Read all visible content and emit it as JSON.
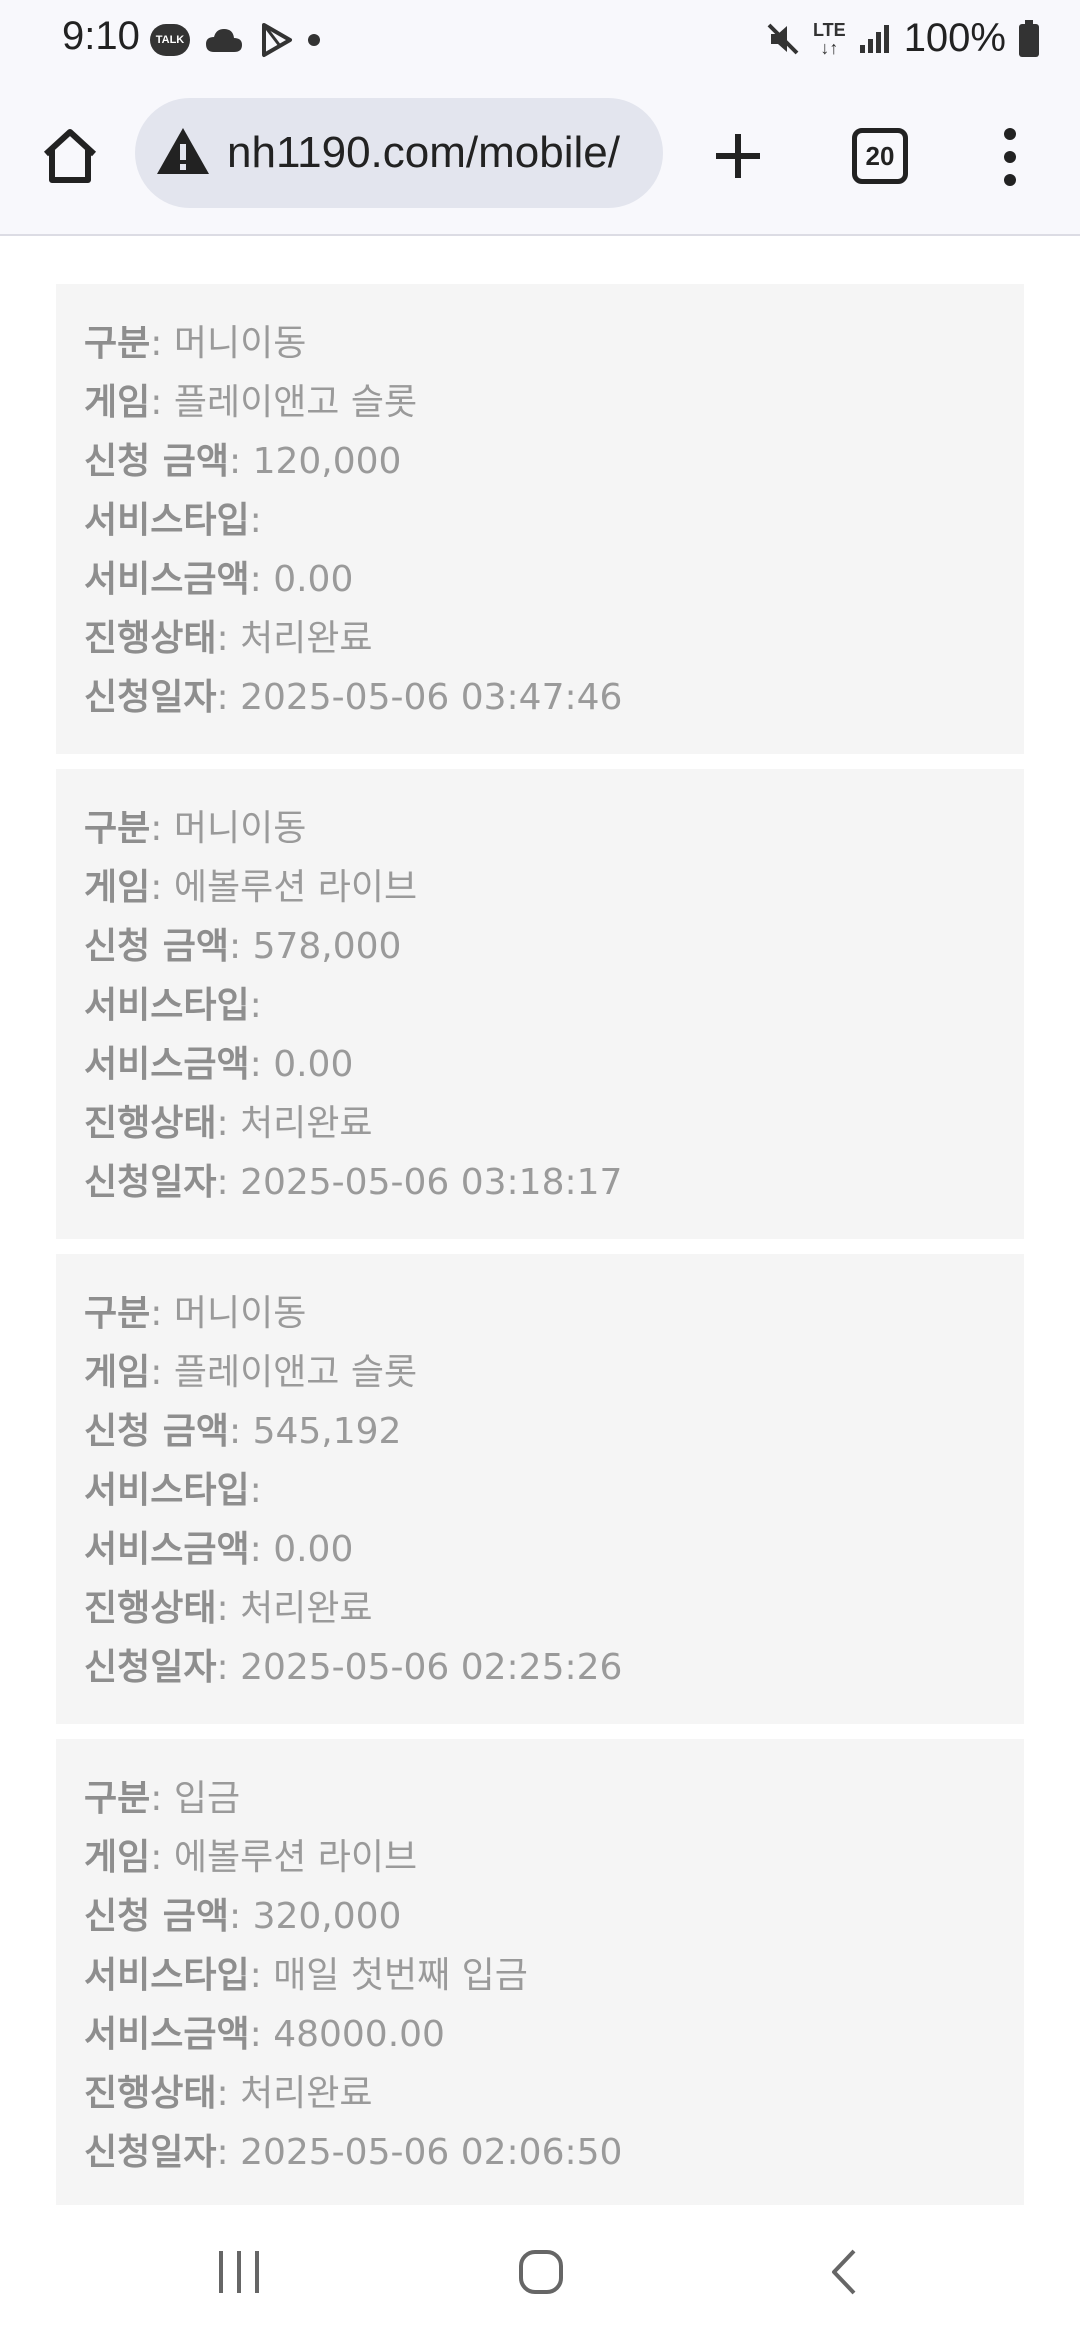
{
  "status_bar": {
    "time": "9:10",
    "talk_badge": "TALK",
    "lte": "LTE",
    "battery": "100%",
    "icons": [
      "kakaotalk-icon",
      "cloud-icon",
      "play-icon",
      "notification-dot-icon",
      "mute-icon",
      "signal-icon",
      "battery-icon"
    ]
  },
  "browser": {
    "url": "nh1190.com/mobile/",
    "tab_count": "20",
    "icons": [
      "home-icon",
      "warning-icon",
      "plus-icon",
      "menu-icon"
    ]
  },
  "labels": {
    "type": "구분",
    "game": "게임",
    "amount": "신청 금액",
    "service_type": "서비스타입",
    "service_amount": "서비스금액",
    "status": "진행상태",
    "date": "신청일자"
  },
  "records": [
    {
      "type": "머니이동",
      "game": "플레이앤고 슬롯",
      "amount": "120,000",
      "service_type": "",
      "service_amount": "0.00",
      "status": "처리완료",
      "date": "2025-05-06 03:47:46"
    },
    {
      "type": "머니이동",
      "game": "에볼루션 라이브",
      "amount": "578,000",
      "service_type": "",
      "service_amount": "0.00",
      "status": "처리완료",
      "date": "2025-05-06 03:18:17"
    },
    {
      "type": "머니이동",
      "game": "플레이앤고 슬롯",
      "amount": "545,192",
      "service_type": "",
      "service_amount": "0.00",
      "status": "처리완료",
      "date": "2025-05-06 02:25:26"
    },
    {
      "type": "입금",
      "game": "에볼루션 라이브",
      "amount": "320,000",
      "service_type": "매일 첫번째 입금",
      "service_amount": "48000.00",
      "status": "처리완료",
      "date": "2025-05-06 02:06:50"
    }
  ],
  "nav_icons": [
    "recent-apps-icon",
    "home-circle-icon",
    "back-icon"
  ]
}
